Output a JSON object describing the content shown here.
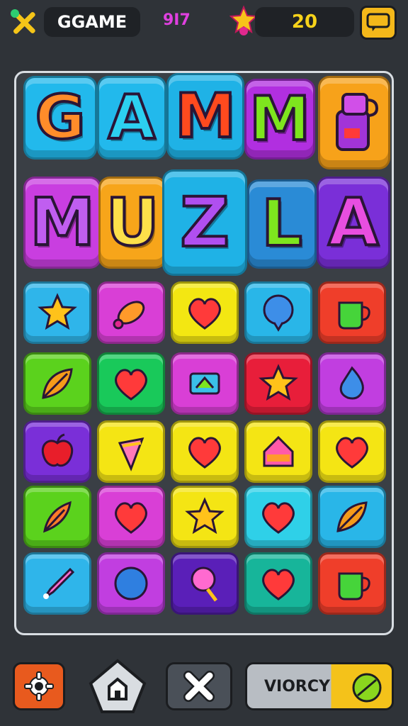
{
  "hud": {
    "game_label": "GGAME",
    "small_label": "9I7",
    "star_count": "20"
  },
  "title_letters": {
    "row1": [
      "G",
      "A",
      "M",
      "M"
    ],
    "row2": [
      "M",
      "U",
      "Z",
      "L",
      "A"
    ]
  },
  "bottom": {
    "action_label": "VIORCY"
  },
  "grid": {
    "rows": [
      [
        {
          "color": "#2fb5ea",
          "icon": "star-icon"
        },
        {
          "color": "#d93fd6",
          "icon": "candy-icon"
        },
        {
          "color": "#f3e712",
          "icon": "heart-icon"
        },
        {
          "color": "#29b6e8",
          "icon": "balloon-icon"
        },
        {
          "color": "#ef3e2a",
          "icon": "cup-icon"
        }
      ],
      [
        {
          "color": "#5bd21d",
          "icon": "leaf-icon"
        },
        {
          "color": "#19c95a",
          "icon": "heart-icon"
        },
        {
          "color": "#d93fd6",
          "icon": "gem-icon"
        },
        {
          "color": "#e81e3a",
          "icon": "star-icon"
        },
        {
          "color": "#c13ee0",
          "icon": "drop-icon"
        }
      ],
      [
        {
          "color": "#7a2fd8",
          "icon": "apple-icon"
        },
        {
          "color": "#f4e514",
          "icon": "icecream-icon"
        },
        {
          "color": "#f4e514",
          "icon": "heart-icon"
        },
        {
          "color": "#f4e514",
          "icon": "house-icon"
        },
        {
          "color": "#f4e514",
          "icon": "heart-icon"
        }
      ],
      [
        {
          "color": "#5bd21d",
          "icon": "feather-icon"
        },
        {
          "color": "#d93fd6",
          "icon": "heart-icon"
        },
        {
          "color": "#f4e514",
          "icon": "star-icon"
        },
        {
          "color": "#2fd0e8",
          "icon": "heart-icon"
        },
        {
          "color": "#29b6e8",
          "icon": "leaf-icon"
        }
      ],
      [
        {
          "color": "#2fb5ea",
          "icon": "rocket-icon"
        },
        {
          "color": "#c13ee0",
          "icon": "ball-icon"
        },
        {
          "color": "#5a1fb8",
          "icon": "lollipop-icon"
        },
        {
          "color": "#17b59a",
          "icon": "heart-icon"
        },
        {
          "color": "#ef3e2a",
          "icon": "cup-icon"
        }
      ]
    ]
  },
  "colors": {
    "background": "#2f3338",
    "accent_yellow": "#f4c21a",
    "gear_button": "#e85a1e"
  }
}
